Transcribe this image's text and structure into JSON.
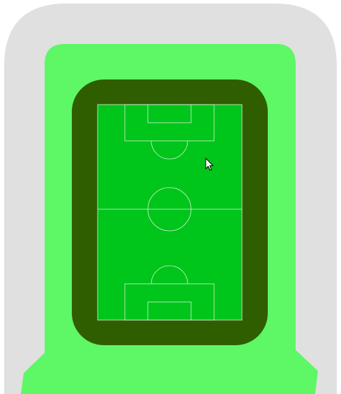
{
  "colors": {
    "outer": "#e0e0e0",
    "stand": "#5ef765",
    "track": "#2f5e00",
    "pitch": "#00c51a",
    "lines": "#d8f4d8"
  },
  "icons": {
    "cursor": "mouse-pointer-icon"
  }
}
